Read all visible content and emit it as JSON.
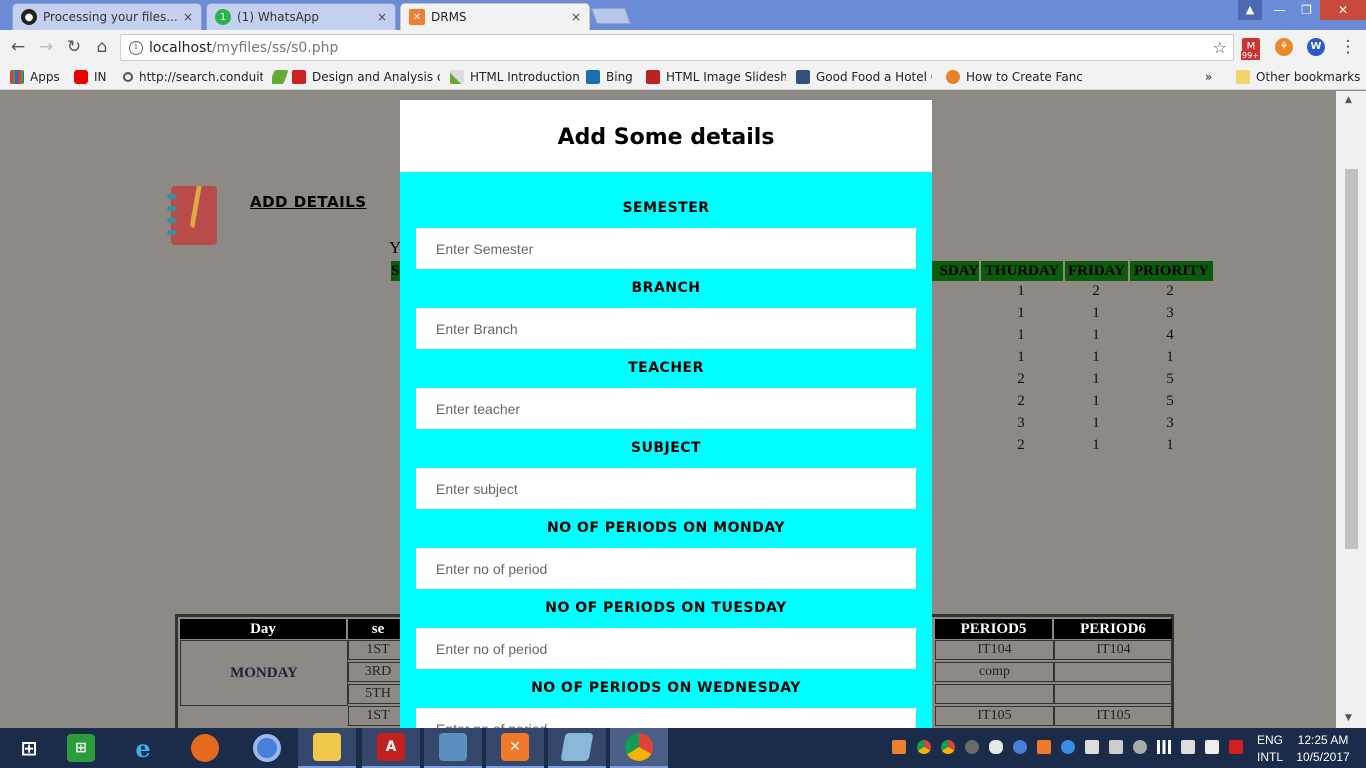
{
  "browser": {
    "tabs": [
      {
        "label": "Processing your files...",
        "icon": "github-icon"
      },
      {
        "label": "(1) WhatsApp",
        "icon": "whatsapp-icon"
      },
      {
        "label": "DRMS",
        "icon": "xampp-icon"
      }
    ],
    "tab_close": "×",
    "url_host": "localhost",
    "url_path": "/myfiles/ss/s0.php",
    "ext_badge": "99+",
    "bookmarks": [
      {
        "label": "Apps"
      },
      {
        "label": "IN"
      },
      {
        "label": "http://search.conduit"
      },
      {
        "label": "Design and Analysis c"
      },
      {
        "label": "HTML Introduction"
      },
      {
        "label": "Bing"
      },
      {
        "label": "HTML Image Slidesho"
      },
      {
        "label": "Good Food a Hotel C"
      },
      {
        "label": "How to Create Fancy"
      }
    ],
    "more_bookmarks": "»",
    "other_bookmarks": "Other bookmarks"
  },
  "page": {
    "add_details_link": "ADD DETAILS",
    "partial_y": "Y",
    "partial_s": "S",
    "grid_headers": [
      "SDAY",
      "THURDAY",
      "FRIDAY",
      "PRIORITY"
    ],
    "grid_rows": [
      [
        "1",
        "2",
        "2"
      ],
      [
        "1",
        "1",
        "3"
      ],
      [
        "1",
        "1",
        "4"
      ],
      [
        "1",
        "1",
        "1"
      ],
      [
        "2",
        "1",
        "5"
      ],
      [
        "2",
        "1",
        "5"
      ],
      [
        "3",
        "1",
        "3"
      ],
      [
        "2",
        "1",
        "1"
      ]
    ],
    "timetable": {
      "headers_left": [
        "Day",
        "se"
      ],
      "headers_right": [
        "PERIOD5",
        "PERIOD6"
      ],
      "day": "MONDAY",
      "sem_rows": [
        "1ST",
        "3RD",
        "5TH",
        "1ST"
      ],
      "right_rows": [
        [
          "IT104",
          "IT104"
        ],
        [
          "comp",
          ""
        ],
        [
          "",
          ""
        ],
        [
          "IT105",
          "IT105"
        ]
      ]
    }
  },
  "modal": {
    "title": "Add Some details",
    "fields": [
      {
        "label": "SEMESTER",
        "placeholder": "Enter Semester"
      },
      {
        "label": "BRANCH",
        "placeholder": "Enter Branch"
      },
      {
        "label": "TEACHER",
        "placeholder": "Enter teacher"
      },
      {
        "label": "SUBJECT",
        "placeholder": "Enter subject"
      },
      {
        "label": "NO OF PERIODS ON MONDAY",
        "placeholder": "Enter no of period"
      },
      {
        "label": "NO OF PERIODS ON TUESDAY",
        "placeholder": "Enter no of period"
      },
      {
        "label": "NO OF PERIODS ON WEDNESDAY",
        "placeholder": "Enter no of period"
      }
    ]
  },
  "taskbar": {
    "lang": "ENG",
    "layout": "INTL",
    "time": "12:25 AM",
    "date": "10/5/2017"
  }
}
